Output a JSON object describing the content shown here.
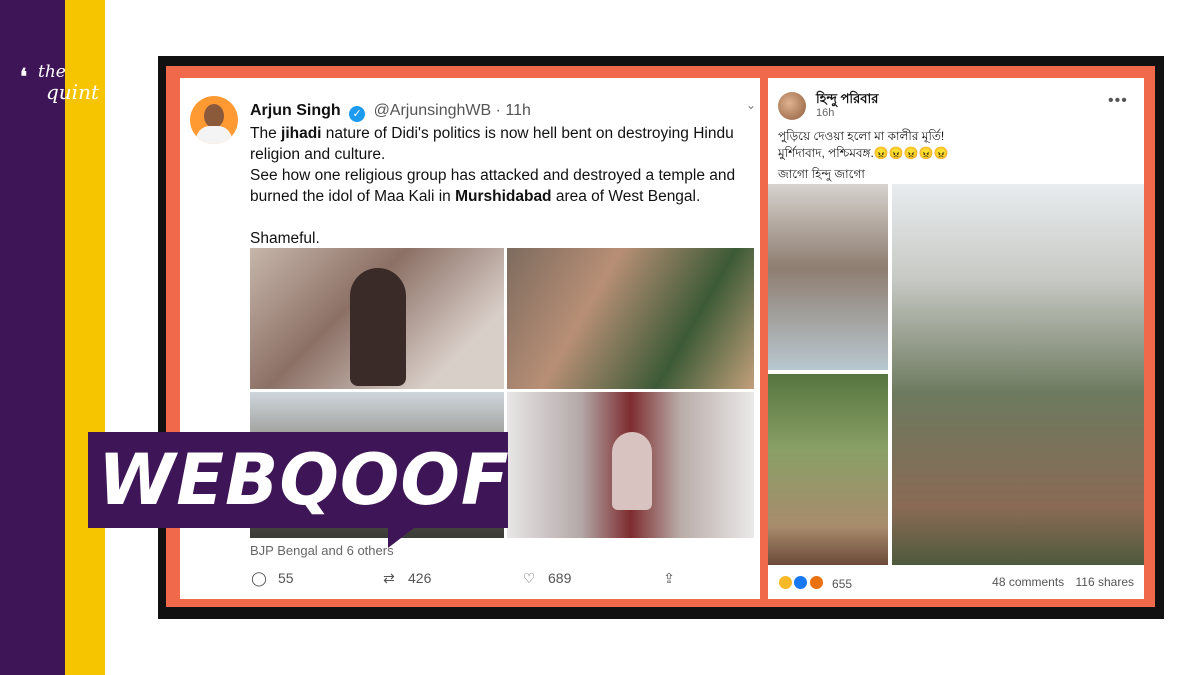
{
  "brand": {
    "logo_line1": "the",
    "logo_line2": "quint",
    "colors": {
      "purple": "#3e1657",
      "yellow": "#f7c400",
      "frame_orange": "#f1694b"
    }
  },
  "badge": {
    "label": "WEBQOOF"
  },
  "tweet": {
    "author_name": "Arjun Singh",
    "handle": "@ArjunsinghWB",
    "separator": "·",
    "time": "11h",
    "body": {
      "line1_pre": "The ",
      "line1_bold": "jihadi",
      "line1_post": " nature of Didi's politics is now hell bent on destroying Hindu religion and culture.",
      "line2_pre": "See how one religious group has attacked and destroyed a temple and burned the idol of Maa Kali in ",
      "line2_bold": "Murshidabad",
      "line2_post": " area of West Bengal.",
      "line3": "Shameful."
    },
    "liked_by": "BJP Bengal and 6 others",
    "replies": "55",
    "retweets": "426",
    "likes": "689"
  },
  "facebook_post": {
    "page_name": "হিন্দু পরিবার",
    "time": "16h",
    "more_icon": "•••",
    "line1": "পুড়িয়ে দেওয়া হলো মা কালীর মূর্তি!",
    "line2": "মুর্শিদাবাদ, পশ্চিমবঙ্গ.😠😠😠😠😠",
    "line3": "জাগো হিন্দু জাগো",
    "reaction_count": "655",
    "comments": "48 comments",
    "shares": "116 shares"
  }
}
